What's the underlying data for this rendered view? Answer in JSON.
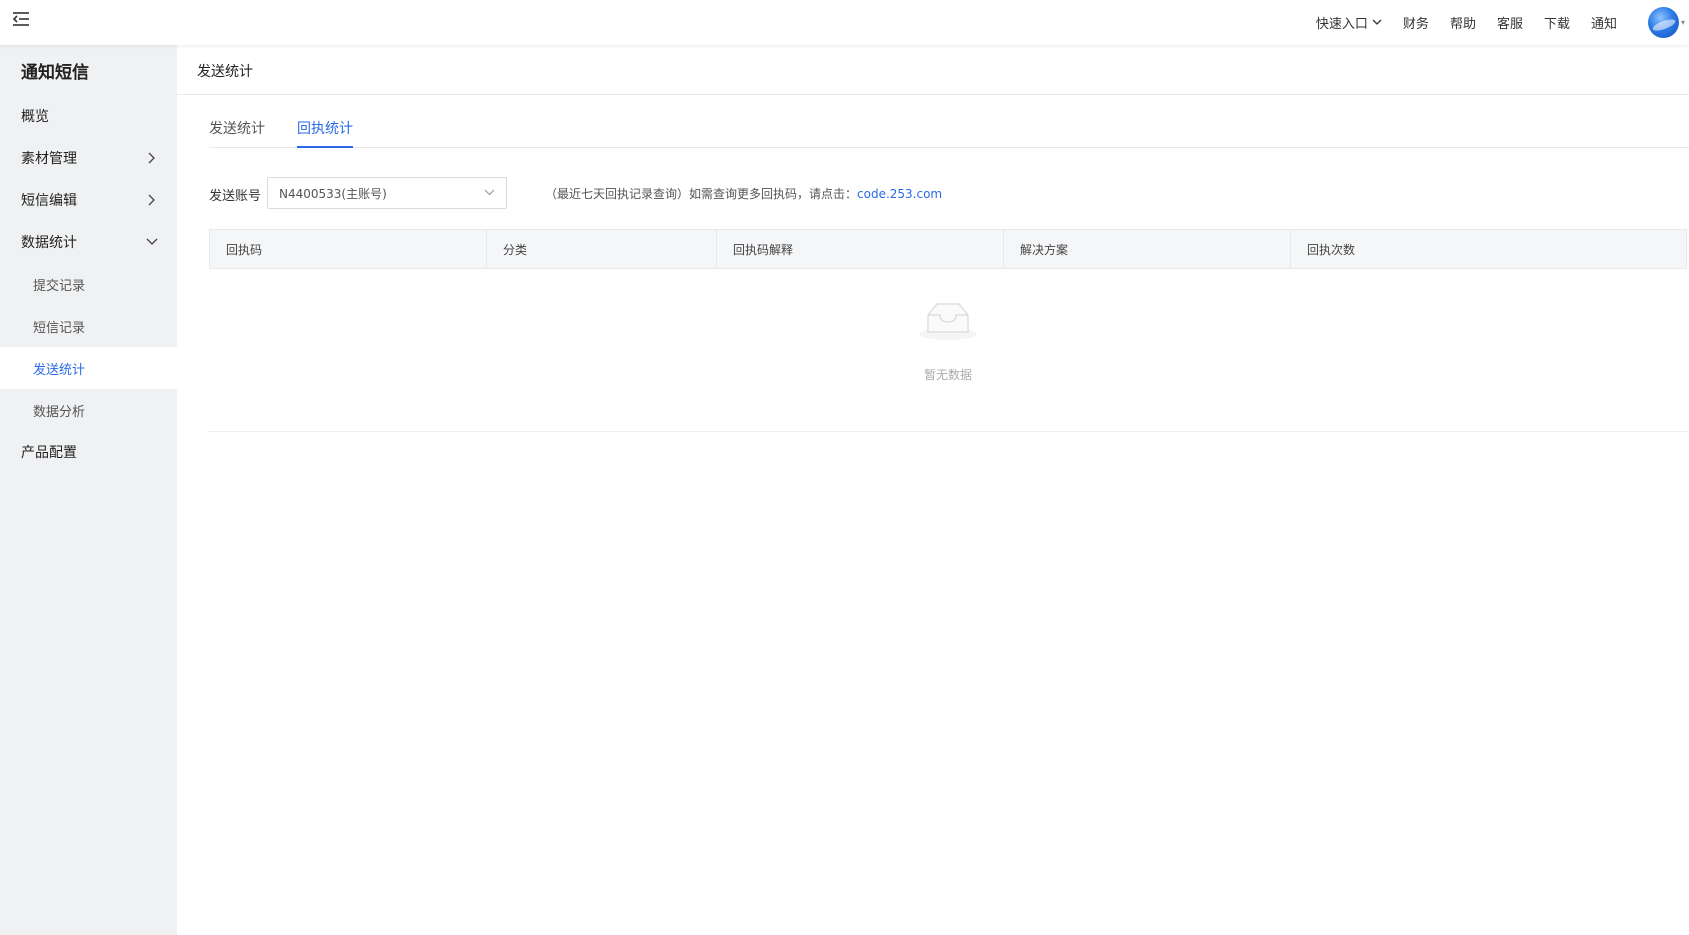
{
  "header": {
    "nav": [
      "快速入口",
      "财务",
      "帮助",
      "客服",
      "下载",
      "通知"
    ]
  },
  "sidebar": {
    "title": "通知短信",
    "items": [
      {
        "label": "概览"
      },
      {
        "label": "素材管理"
      },
      {
        "label": "短信编辑"
      },
      {
        "label": "数据统计"
      }
    ],
    "sub_items": [
      {
        "label": "提交记录"
      },
      {
        "label": "短信记录"
      },
      {
        "label": "发送统计"
      },
      {
        "label": "数据分析"
      }
    ],
    "last_item": {
      "label": "产品配置"
    },
    "active": "发送统计"
  },
  "main": {
    "page_title": "发送统计",
    "tabs": [
      {
        "label": "发送统计"
      },
      {
        "label": "回执统计"
      }
    ],
    "active_tab": "回执统计",
    "filter": {
      "label": "发送账号",
      "value": "N4400533(主账号)"
    },
    "hint": {
      "text": "（最近七天回执记录查询）如需查询更多回执码，请点击：",
      "link": "code.253.com"
    },
    "table": {
      "columns": [
        "回执码",
        "分类",
        "回执码解释",
        "解决方案",
        "回执次数"
      ],
      "rows": [],
      "empty_text": "暂无数据"
    }
  },
  "colors": {
    "accent": "#2a6ae8",
    "sidebar_bg": "#f0f1f3",
    "header_bg": "#f5f6f8"
  }
}
